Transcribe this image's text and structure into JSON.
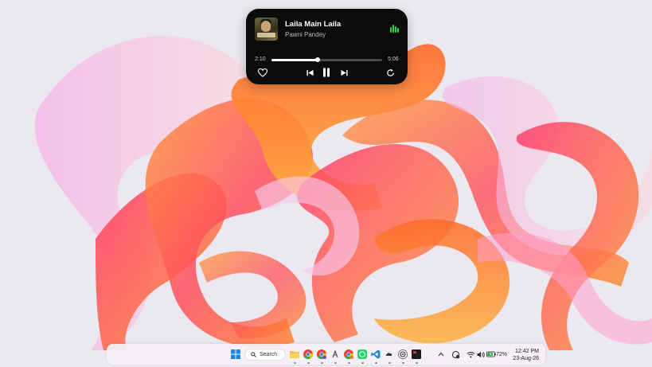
{
  "player": {
    "track_title": "Laila Main Laila",
    "artist": "Pawni Pandey",
    "elapsed": "2:10",
    "total": "5:06",
    "progress_fraction": 0.42,
    "album_art_icon": "album-art-thumbnail",
    "controls": {
      "like_icon": "heart-icon",
      "previous_icon": "skip-previous-icon",
      "play_pause_icon": "pause-icon",
      "next_icon": "skip-next-icon",
      "repeat_icon": "repeat-icon",
      "playing_indicator_icon": "equalizer-icon"
    },
    "accent_color": "#2fd35a"
  },
  "taskbar": {
    "search_label": "Search",
    "apps": [
      {
        "name": "start",
        "icon": "windows-start-icon"
      },
      {
        "name": "file-explorer",
        "icon": "folder-icon"
      },
      {
        "name": "chrome",
        "icon": "chrome-icon"
      },
      {
        "name": "chrome-profile",
        "icon": "chrome-icon"
      },
      {
        "name": "app-a",
        "icon": "letter-a-icon"
      },
      {
        "name": "chrome-2",
        "icon": "chrome-icon"
      },
      {
        "name": "whatsapp",
        "icon": "whatsapp-icon"
      },
      {
        "name": "vscode",
        "icon": "vscode-icon"
      },
      {
        "name": "cloud-app",
        "icon": "cloud-icon"
      },
      {
        "name": "chatgpt",
        "icon": "chatgpt-icon"
      },
      {
        "name": "terminal",
        "icon": "terminal-icon"
      }
    ],
    "tray": {
      "battery_percent": "72%",
      "time": "12:42 PM",
      "date": "23-Aug-26"
    }
  }
}
